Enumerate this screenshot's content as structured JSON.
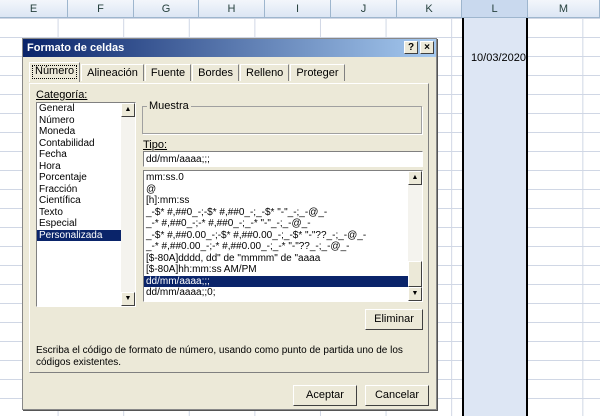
{
  "sheet": {
    "columns": [
      "E",
      "F",
      "G",
      "H",
      "I",
      "J",
      "K",
      "L",
      "M"
    ],
    "cell_L3": "10/03/2020"
  },
  "dialog": {
    "title": "Formato de celdas",
    "help": "?",
    "close": "×",
    "tabs": [
      "Número",
      "Alineación",
      "Fuente",
      "Bordes",
      "Relleno",
      "Proteger"
    ],
    "categoria_label": "Categoría:",
    "categories": [
      "General",
      "Número",
      "Moneda",
      "Contabilidad",
      "Fecha",
      "Hora",
      "Porcentaje",
      "Fracción",
      "Científica",
      "Texto",
      "Especial",
      "Personalizada"
    ],
    "selected_category": "Personalizada",
    "muestra_label": "Muestra",
    "tipo_label": "Tipo:",
    "tipo_value": "dd/mm/aaaa;;;",
    "formats": [
      "mm:ss.0",
      "@",
      "[h]:mm:ss",
      "_-$* #,##0_-;-$* #,##0_-;_-$* \"-\"_-;_-@_-",
      "_-* #,##0_-;-* #,##0_-;_-* \"-\"_-;_-@_-",
      "_-$* #,##0.00_-;-$* #,##0.00_-;_-$* \"-\"??_-;_-@_-",
      "_-* #,##0.00_-;-* #,##0.00_-;_-* \"-\"??_-;_-@_-",
      "[$-80A]dddd, dd\" de \"mmmm\" de \"aaaa",
      "[$-80A]hh:mm:ss AM/PM",
      "dd/mm/aaaa;;;",
      "dd/mm/aaaa;;0;"
    ],
    "selected_format": "dd/mm/aaaa;;;",
    "eliminar": "Eliminar",
    "description": "Escriba el código de formato de número, usando como punto de partida uno de los códigos existentes.",
    "aceptar": "Aceptar",
    "cancelar": "Cancelar"
  }
}
